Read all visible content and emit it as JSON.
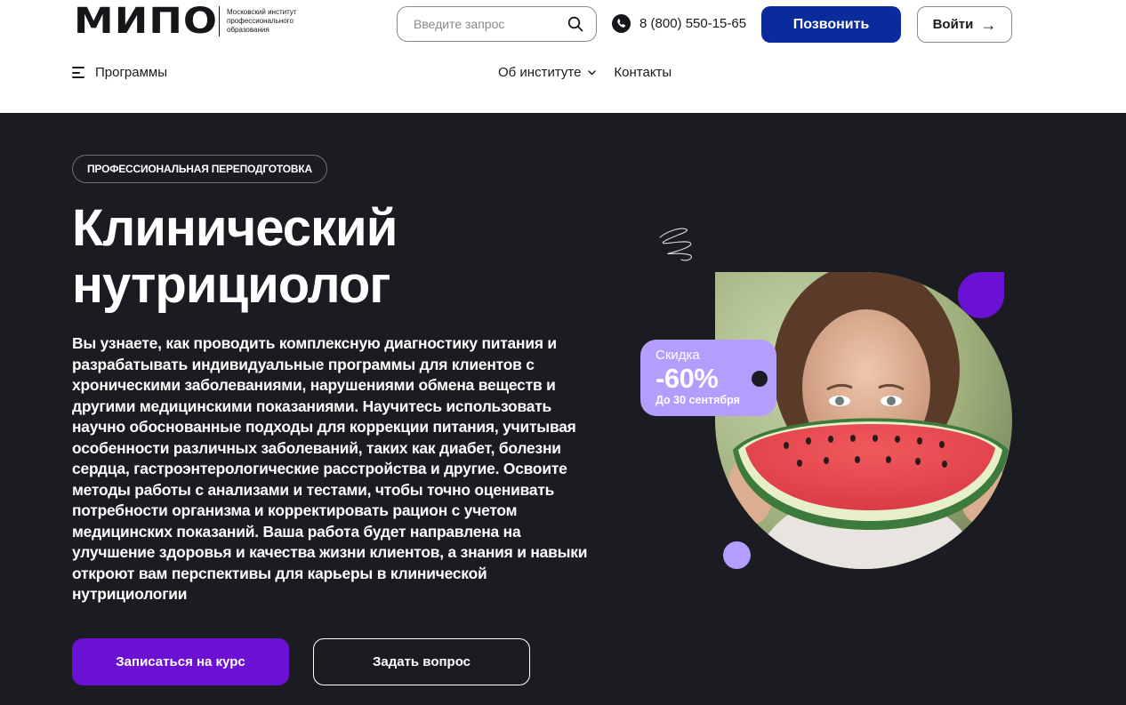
{
  "header": {
    "logo": {
      "mark": "МИПО",
      "subtitle": "Московский институт профессионального образования"
    },
    "search": {
      "placeholder": "Введите запрос",
      "icon": "search-icon"
    },
    "phone": {
      "number": "8 (800) 550-15-65",
      "icon": "phone-icon"
    },
    "call_button": "Позвонить",
    "login_button": "Войти",
    "login_arrow": "→",
    "programs_label": "Программы",
    "nav": [
      {
        "label": "Об институте",
        "has_dropdown": true
      },
      {
        "label": "Контакты",
        "has_dropdown": false
      }
    ]
  },
  "hero": {
    "tag": "ПРОФЕССИОНАЛЬНАЯ ПЕРЕПОДГОТОВКА",
    "title_line1": "Клинический",
    "title_line2": "нутрициолог",
    "description": "Вы узнаете, как проводить комплексную диагностику питания и разрабатывать индивидуальные программы для клиентов с хроническими заболеваниями, нарушениями обмена веществ и другими медицинскими показаниями. Научитесь использовать научно обоснованные подходы для коррекции питания, учитывая особенности различных заболеваний, таких как диабет, болезни сердца, гастроэнтерологические расстройства и другие. Освоите методы работы с анализами и тестами, чтобы точно оценивать потребности организма и корректировать рацион с учетом медицинских показаний. Ваша работа будет направлена на улучшение здоровья и качества жизни клиентов, а знания и навыки откроют вам перспективы для карьеры в клинической нутрициологии",
    "enroll_button": "Записаться на курс",
    "ask_button": "Задать вопрос",
    "discount": {
      "label": "Скидка",
      "value": "-60%",
      "until": "До 30 сентября"
    }
  },
  "colors": {
    "hero_bg": "#1b1c21",
    "primary_blue": "#0a2b9c",
    "accent_purple": "#6a11d4",
    "lavender": "#b39dff"
  }
}
